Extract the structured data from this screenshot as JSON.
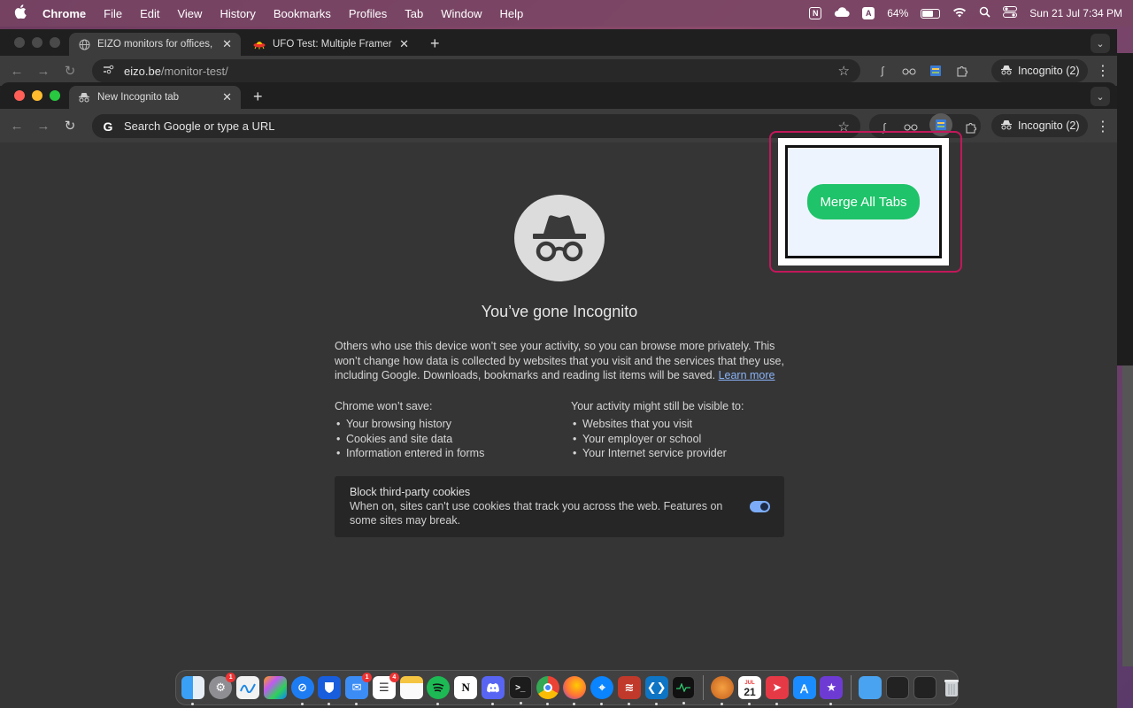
{
  "menubar": {
    "app_name": "Chrome",
    "menus": [
      "File",
      "Edit",
      "View",
      "History",
      "Bookmarks",
      "Profiles",
      "Tab",
      "Window",
      "Help"
    ],
    "battery_percent": "64%",
    "battery_level": 0.64,
    "datetime": "Sun 21 Jul  7:34 PM",
    "status_icons": [
      "notion-menu-icon",
      "cloud-icon",
      "input-source-icon",
      "battery-icon",
      "wifi-icon",
      "spotlight-icon",
      "control-center-icon"
    ]
  },
  "back_window": {
    "tabs": [
      {
        "title": "EIZO monitors for offices, pho",
        "icon": "globe-icon",
        "active": true
      },
      {
        "title": "UFO Test: Multiple Framerate",
        "icon": "ufo-icon",
        "active": false
      }
    ],
    "url_host": "eizo.be",
    "url_path": "/monitor-test/",
    "incognito_label": "Incognito (2)"
  },
  "front_window": {
    "tab_title": "New Incognito tab",
    "omnibox_placeholder": "Search Google or type a URL",
    "incognito_label": "Incognito (2)"
  },
  "incognito_page": {
    "heading": "You’ve gone Incognito",
    "description": "Others who use this device won’t see your activity, so you can browse more privately. This won’t change how data is collected by websites that you visit and the services that they use, including Google. Downloads, bookmarks and reading list items will be saved.",
    "learn_more": "Learn more",
    "wont_save_heading": "Chrome won’t save:",
    "wont_save_items": [
      "Your browsing history",
      "Cookies and site data",
      "Information entered in forms"
    ],
    "visible_heading_pre": "Your activity ",
    "visible_heading_em": "might",
    "visible_heading_post": " still be visible to:",
    "visible_items": [
      "Websites that you visit",
      "Your employer or school",
      "Your Internet service provider"
    ],
    "cookie_title": "Block third-party cookies",
    "cookie_desc": "When on, sites can't use cookies that track you across the web. Features on some sites may break.",
    "cookie_toggle_on": true
  },
  "popup": {
    "merge_button": "Merge All Tabs"
  },
  "dock": {
    "badges": {
      "settings": "1",
      "mail": "1",
      "reminders": "4"
    },
    "calendar_day": "21",
    "calendar_month": "JUL",
    "notion_letter": "N"
  }
}
